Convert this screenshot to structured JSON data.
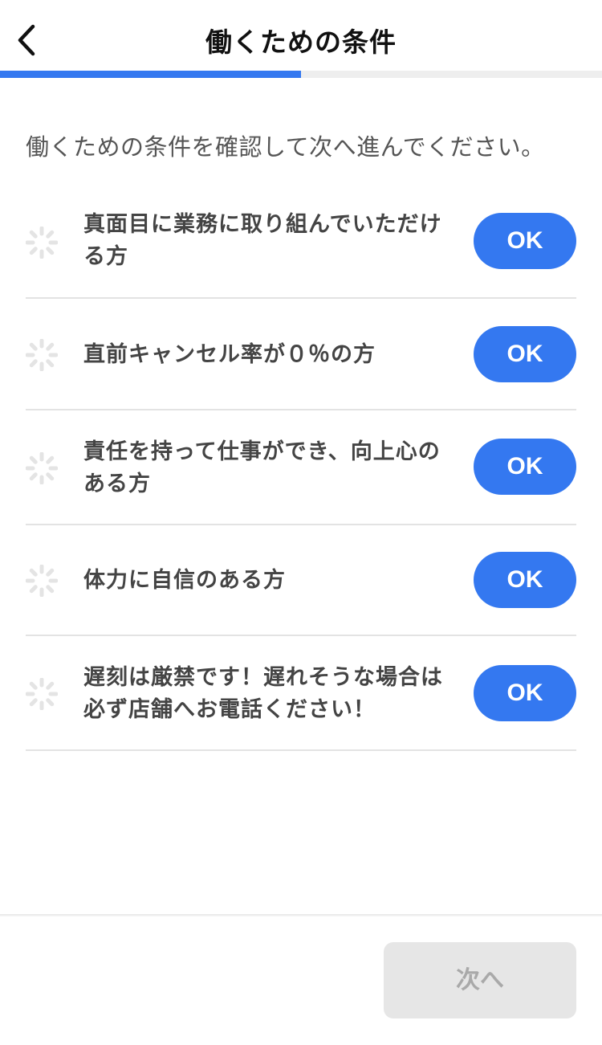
{
  "header": {
    "title": "働くための条件",
    "back_icon": "chevron-left-icon"
  },
  "progress": {
    "fraction": 0.5,
    "color": "#3478f0"
  },
  "intro": "働くための条件を確認して次へ進んでください。",
  "conditions": [
    {
      "text": "真面目に業務に取り組んでいただける方",
      "button": "OK"
    },
    {
      "text": "直前キャンセル率が０％の方",
      "button": "OK"
    },
    {
      "text": "責任を持って仕事ができ、向上心のある方",
      "button": "OK"
    },
    {
      "text": "体力に自信のある方",
      "button": "OK"
    },
    {
      "text": "遅刻は厳禁です！遅れそうな場合は必ず店舗へお電話ください！",
      "button": "OK"
    }
  ],
  "footer": {
    "next_label": "次へ"
  },
  "colors": {
    "accent": "#3478f0",
    "disabled_bg": "#e6e6e6",
    "disabled_text": "#a9a9a9"
  }
}
